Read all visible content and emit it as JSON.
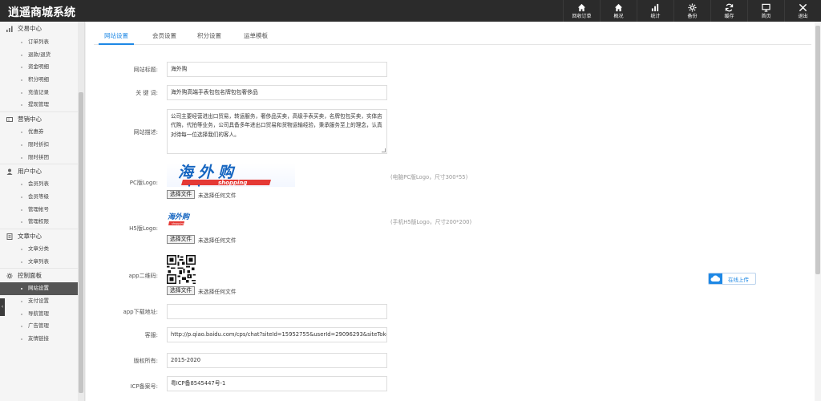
{
  "app": {
    "title": "逍遥商城系统"
  },
  "topnav": [
    {
      "label": "回收订单",
      "icon": "home-icon"
    },
    {
      "label": "概况",
      "icon": "home-icon"
    },
    {
      "label": "统计",
      "icon": "bar-chart-icon"
    },
    {
      "label": "备份",
      "icon": "gear-icon"
    },
    {
      "label": "缓存",
      "icon": "refresh-icon"
    },
    {
      "label": "首页",
      "icon": "monitor-icon"
    },
    {
      "label": "退出",
      "icon": "close-icon"
    }
  ],
  "sidebar": {
    "groups": [
      {
        "title": "交易中心",
        "icon": "bar-chart-icon",
        "items": [
          "订单列表",
          "退款/退货",
          "资金明细",
          "积分明细",
          "充值记录",
          "提现管理"
        ]
      },
      {
        "title": "营销中心",
        "icon": "ticket-icon",
        "items": [
          "优惠券",
          "限时折扣",
          "限时拼团"
        ]
      },
      {
        "title": "用户中心",
        "icon": "user-icon",
        "items": [
          "会员列表",
          "会员等级",
          "管理帐号",
          "管理权限"
        ]
      },
      {
        "title": "文章中心",
        "icon": "document-icon",
        "items": [
          "文章分类",
          "文章列表"
        ]
      },
      {
        "title": "控制面板",
        "icon": "gear-icon",
        "items": [
          "网站设置",
          "支付设置",
          "导航管理",
          "广告管理",
          "友情链接"
        ]
      }
    ],
    "active_item": "网站设置"
  },
  "tabs": [
    "网站设置",
    "会员设置",
    "积分设置",
    "运单模板"
  ],
  "form": {
    "site_title": {
      "label": "网站标题:",
      "value": "海外购"
    },
    "keywords": {
      "label": "关 键 词:",
      "value": "海外购高端手表包包名牌包包奢侈品"
    },
    "description": {
      "label": "网站描述:",
      "value": "公司主要经营进出口贸易，转运服务，奢侈品买卖，高级手表买卖，名牌包包买卖，实体店代购，代拍等业务，公司具备多年进出口贸易和货物运输经验，秉承服务至上的理念，认真对待每一位选择我们的客人。"
    },
    "pc_logo": {
      "label": "PC版Logo:",
      "hint": "(电脑PC版Logo，尺寸300*55)",
      "logo_text": "海外购",
      "logo_sub": "shopping"
    },
    "h5_logo": {
      "label": "H5版Logo:",
      "hint": "(手机H5版Logo，尺寸200*200)",
      "logo_text": "海外购",
      "logo_sub": "shopping"
    },
    "app_qr": {
      "label": "app二维码:"
    },
    "file_button": "选择文件",
    "file_none": "未选择任何文件",
    "app_download": {
      "label": "app下载地址:",
      "value": ""
    },
    "service": {
      "label": "客服:",
      "value": "http://p.qiao.baidu.com/cps/chat?siteId=15952755&userId=29096293&siteToken=d979"
    },
    "copyright": {
      "label": "版权所有:",
      "value": "2015-2020"
    },
    "icp": {
      "label": "ICP备案号:",
      "value": "粤ICP备8545447号-1"
    }
  },
  "upload": {
    "label": "在线上传"
  },
  "colors": {
    "accent": "#1e88e5",
    "topbar": "#2b2b2b",
    "logo_blue": "#1565c0",
    "logo_red": "#e53935"
  }
}
